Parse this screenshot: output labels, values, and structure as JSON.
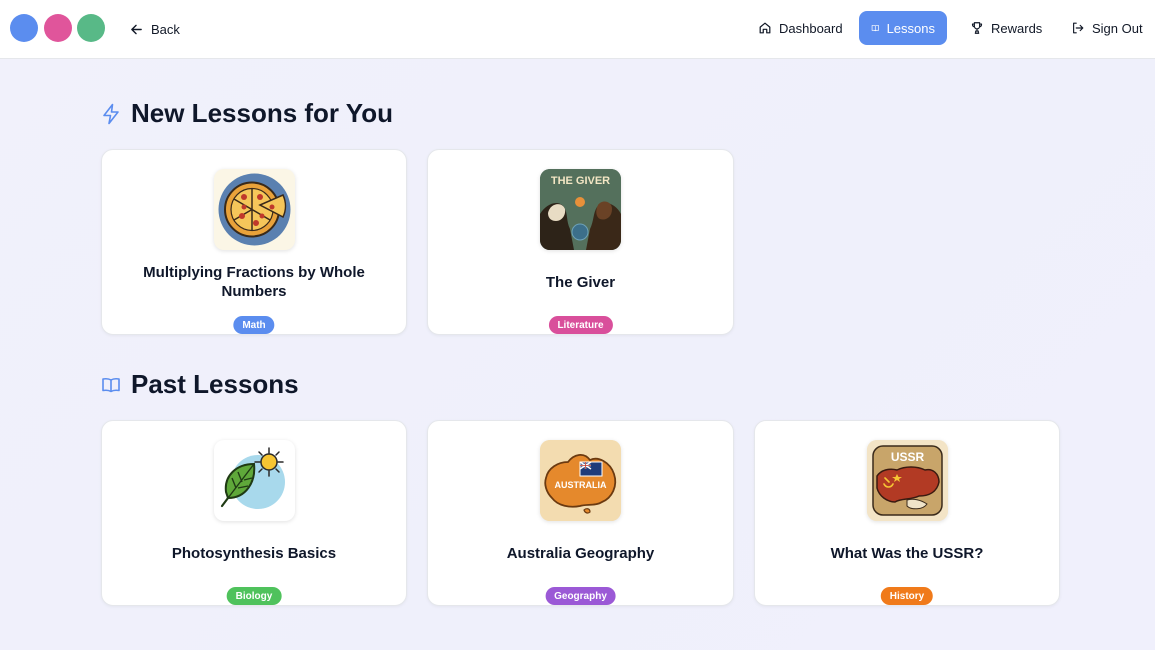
{
  "window_dots": [
    {
      "name": "blue",
      "color": "#5b8def"
    },
    {
      "name": "pink",
      "color": "#e0559b"
    },
    {
      "name": "green",
      "color": "#58b987"
    }
  ],
  "header": {
    "back_label": "Back",
    "nav": [
      {
        "label": "Dashboard",
        "icon": "home-icon",
        "active": false
      },
      {
        "label": "Lessons",
        "icon": "book-icon",
        "active": true
      },
      {
        "label": "Rewards",
        "icon": "trophy-icon",
        "active": false
      },
      {
        "label": "Sign Out",
        "icon": "sign-out-icon",
        "active": false
      }
    ],
    "accent_color": "#5b8def"
  },
  "new_lessons": {
    "title": "New Lessons for You",
    "icon": "lightning-icon",
    "items": [
      {
        "title": "Multiplying Fractions by Whole Numbers",
        "tag": "Math",
        "tag_color": "#5b8def",
        "thumbnail": "pizza-icon"
      },
      {
        "title": "The Giver",
        "tag": "Literature",
        "tag_color": "#d94f9b",
        "thumbnail": "the-giver-cover"
      }
    ]
  },
  "past_lessons": {
    "title": "Past Lessons",
    "icon": "book-open-icon",
    "items": [
      {
        "title": "Photosynthesis Basics",
        "tag": "Biology",
        "tag_color": "#4fc25c",
        "thumbnail": "leaf-sun-icon"
      },
      {
        "title": "Australia Geography",
        "tag": "Geography",
        "tag_color": "#9b59d6",
        "thumbnail": "australia-map-icon",
        "thumbnail_text": "AUSTRALIA"
      },
      {
        "title": "What Was the USSR?",
        "tag": "History",
        "tag_color": "#f07a1a",
        "thumbnail": "ussr-map-icon",
        "thumbnail_text": "USSR"
      }
    ]
  },
  "giver_cover_text": "THE GIVER"
}
